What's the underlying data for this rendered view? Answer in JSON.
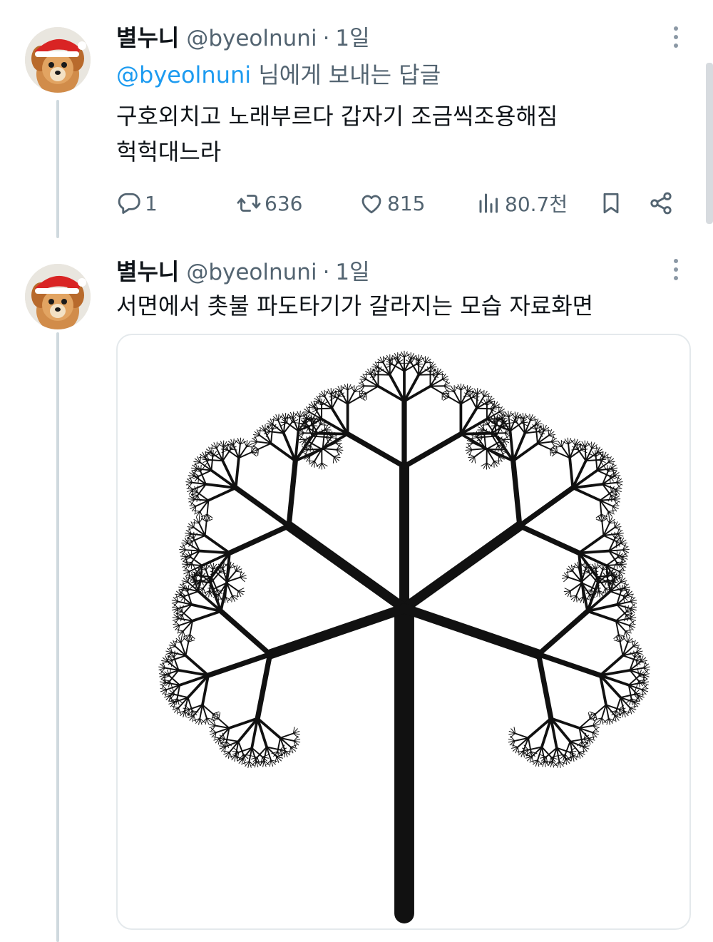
{
  "tweets": [
    {
      "display_name": "별누니",
      "handle": "@byeolnuni",
      "separator": "·",
      "time": "1일",
      "replying_mention": "@byeolnuni",
      "replying_suffix": " 님에게 보내는 답글",
      "text_lines": [
        "구호외치고 노래부르다 갑자기 조금씩조용해짐",
        "헉헉대느라"
      ],
      "stats": {
        "replies": "1",
        "reposts": "636",
        "likes": "815",
        "views": "80.7천"
      }
    },
    {
      "display_name": "별누니",
      "handle": "@byeolnuni",
      "separator": "·",
      "time": "1일",
      "text_lines": [
        "서면에서 촛불 파도타기가 갈라지는 모습 자료화면"
      ]
    }
  ],
  "icons": {
    "reply": "reply-icon",
    "repost": "repost-icon",
    "like": "heart-icon",
    "views": "views-icon",
    "bookmark": "bookmark-icon",
    "share": "share-icon",
    "more": "more-icon"
  },
  "colors": {
    "text": "#0f1419",
    "secondary": "#536471",
    "link": "#1d9bf0",
    "thread_line": "#cfd9de",
    "media_border": "#e4e9ec"
  }
}
